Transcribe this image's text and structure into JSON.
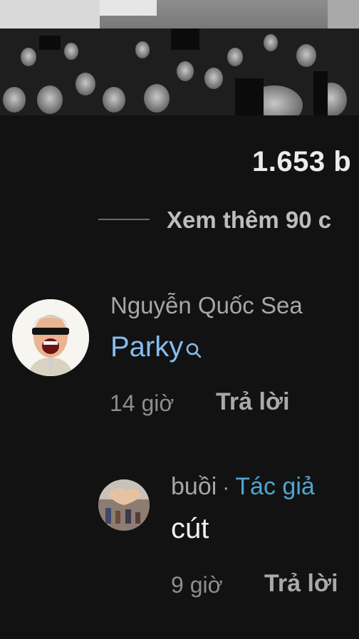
{
  "post": {
    "count_text": "1.653 b",
    "view_more_text": "Xem thêm 90 c"
  },
  "comment": {
    "author": "Nguyễn Quốc Sea",
    "mention": "Parky",
    "mention_icon": "search-icon",
    "time": "14 giờ",
    "reply_label": "Trả lời"
  },
  "reply": {
    "author": "buồi",
    "separator": "·",
    "author_badge": "Tác giả",
    "text": "cút",
    "time": "9 giờ",
    "reply_label": "Trả lời"
  },
  "colors": {
    "background": "#121212",
    "mention": "#86bdf0",
    "author_badge": "#4fa5cf",
    "muted_text": "#a7a7a7"
  }
}
